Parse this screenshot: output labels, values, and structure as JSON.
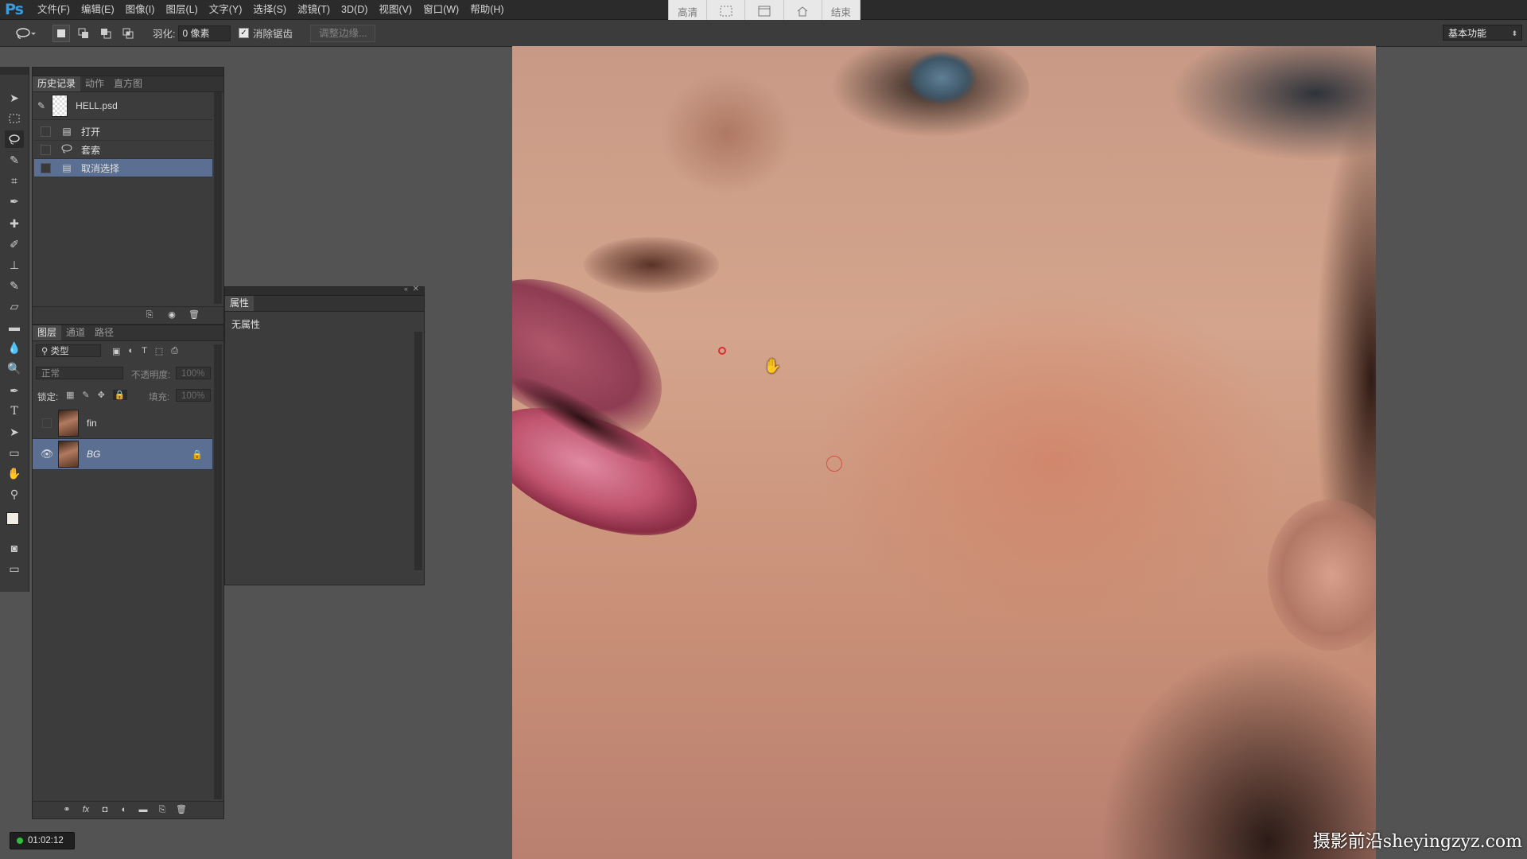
{
  "app": {
    "logo": "Ps"
  },
  "menu": [
    "文件(F)",
    "编辑(E)",
    "图像(I)",
    "图层(L)",
    "文字(Y)",
    "选择(S)",
    "滤镜(T)",
    "3D(D)",
    "视图(V)",
    "窗口(W)",
    "帮助(H)"
  ],
  "screen_bar": {
    "left": "高清",
    "right": "结束"
  },
  "options": {
    "feather_label": "羽化:",
    "feather_value": "0 像素",
    "antialias_label": "消除锯齿",
    "antialias_checked": true,
    "refine_edge": "调整边缘...",
    "workspace": "基本功能"
  },
  "history_panel": {
    "tabs": [
      "历史记录",
      "动作",
      "直方图"
    ],
    "snapshot": "HELL.psd",
    "steps": [
      {
        "label": "打开",
        "icon": "document-icon"
      },
      {
        "label": "套索",
        "icon": "lasso-icon"
      },
      {
        "label": "取消选择",
        "icon": "document-icon"
      }
    ],
    "selected_index": 2
  },
  "layers_panel": {
    "tabs": [
      "图层",
      "通道",
      "路径"
    ],
    "filter": "类型",
    "blend_mode": "正常",
    "opacity_label": "不透明度:",
    "opacity_value": "100%",
    "lock_label": "锁定:",
    "fill_label": "填充:",
    "fill_value": "100%",
    "layers": [
      {
        "name": "fin",
        "visible": false,
        "locked": false,
        "selected": false
      },
      {
        "name": "BG",
        "visible": true,
        "locked": true,
        "selected": true
      }
    ]
  },
  "properties_panel": {
    "title": "属性",
    "content": "无属性"
  },
  "timer": "01:02:12",
  "watermark": "摄影前沿sheyingzyz.com",
  "colors": {
    "accent_selected": "#5a6f91",
    "ps_blue": "#3d9bdc",
    "timer_green": "#2fbf3a"
  }
}
